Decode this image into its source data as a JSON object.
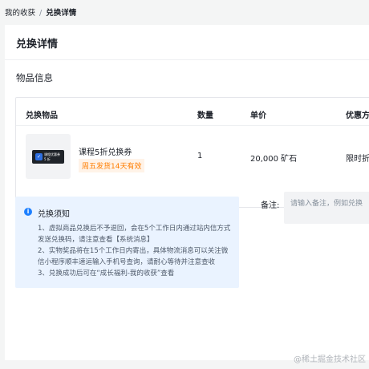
{
  "breadcrumb": {
    "parent": "我的收获",
    "separator": "/",
    "current": "兑换详情"
  },
  "page": {
    "title": "兑换详情",
    "section_title": "物品信息"
  },
  "table": {
    "headers": {
      "item": "兑换物品",
      "qty": "数量",
      "price": "单价",
      "discount": "优惠方"
    },
    "row": {
      "name": "课程5折兑换券",
      "tag": "周五发货14天有效",
      "coupon_icon_text": "✓",
      "coupon_line1": "课程优惠券",
      "coupon_line2": "5 折",
      "qty": "1",
      "price": "20,000 矿石",
      "discount": "限时折"
    }
  },
  "notice": {
    "icon_text": "i",
    "title": "兑换须知",
    "items": [
      "1、虚拟商品兑换后不予退回，会在5个工作日内通过站内信方式",
      "发送兑换码，请注意查看【系统消息】",
      "2、实物奖品将在15个工作日内寄出，具体物流消息可以关注微",
      "信小程序顺丰速运输入手机号查询，请耐心等待并注意查收",
      "3、兑换成功后可在“成长福利-我的收获”查看"
    ]
  },
  "remark": {
    "label": "备注:",
    "placeholder": "请输入备注，例如兑换"
  },
  "watermark": "@稀土掘金技术社区",
  "colors": {
    "accent": "#1e80ff",
    "tag_text": "#ff7d00",
    "notice_bg": "#eaf3ff"
  }
}
